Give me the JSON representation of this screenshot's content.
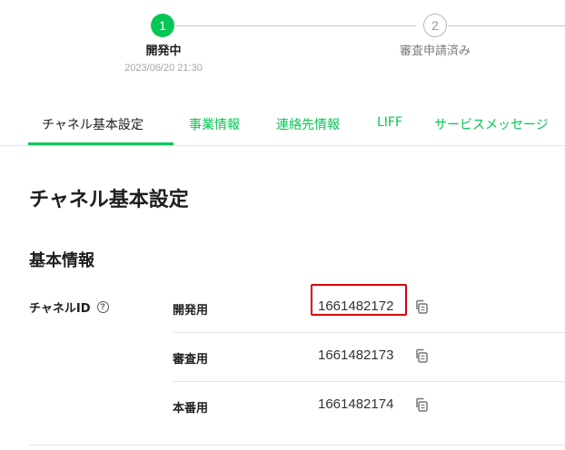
{
  "stepper": {
    "steps": [
      {
        "number": "1",
        "label": "開発中",
        "date": "2023/06/20 21:30",
        "state": "active"
      },
      {
        "number": "2",
        "label": "審査申請済み",
        "state": "pending"
      }
    ],
    "active_color": "#06c755"
  },
  "tabs": [
    {
      "label": "チャネル基本設定",
      "active": true
    },
    {
      "label": "事業情報",
      "active": false
    },
    {
      "label": "連絡先情報",
      "active": false
    },
    {
      "label": "LIFF",
      "active": false
    },
    {
      "label": "サービスメッセージ",
      "active": false
    }
  ],
  "page": {
    "title": "チャネル基本設定",
    "section_title": "基本情報"
  },
  "channel_id": {
    "label": "チャネルID",
    "help_icon": "?",
    "rows": [
      {
        "label": "開発用",
        "value": "1661482172",
        "highlighted": true,
        "icon": "copy-icon"
      },
      {
        "label": "審査用",
        "value": "1661482173",
        "highlighted": false,
        "icon": "copy-icon"
      },
      {
        "label": "本番用",
        "value": "1661482174",
        "highlighted": false,
        "icon": "copy-icon"
      }
    ]
  },
  "colors": {
    "accent": "#06c755",
    "highlight": "#e0000e",
    "text": "#1e1e1e"
  }
}
